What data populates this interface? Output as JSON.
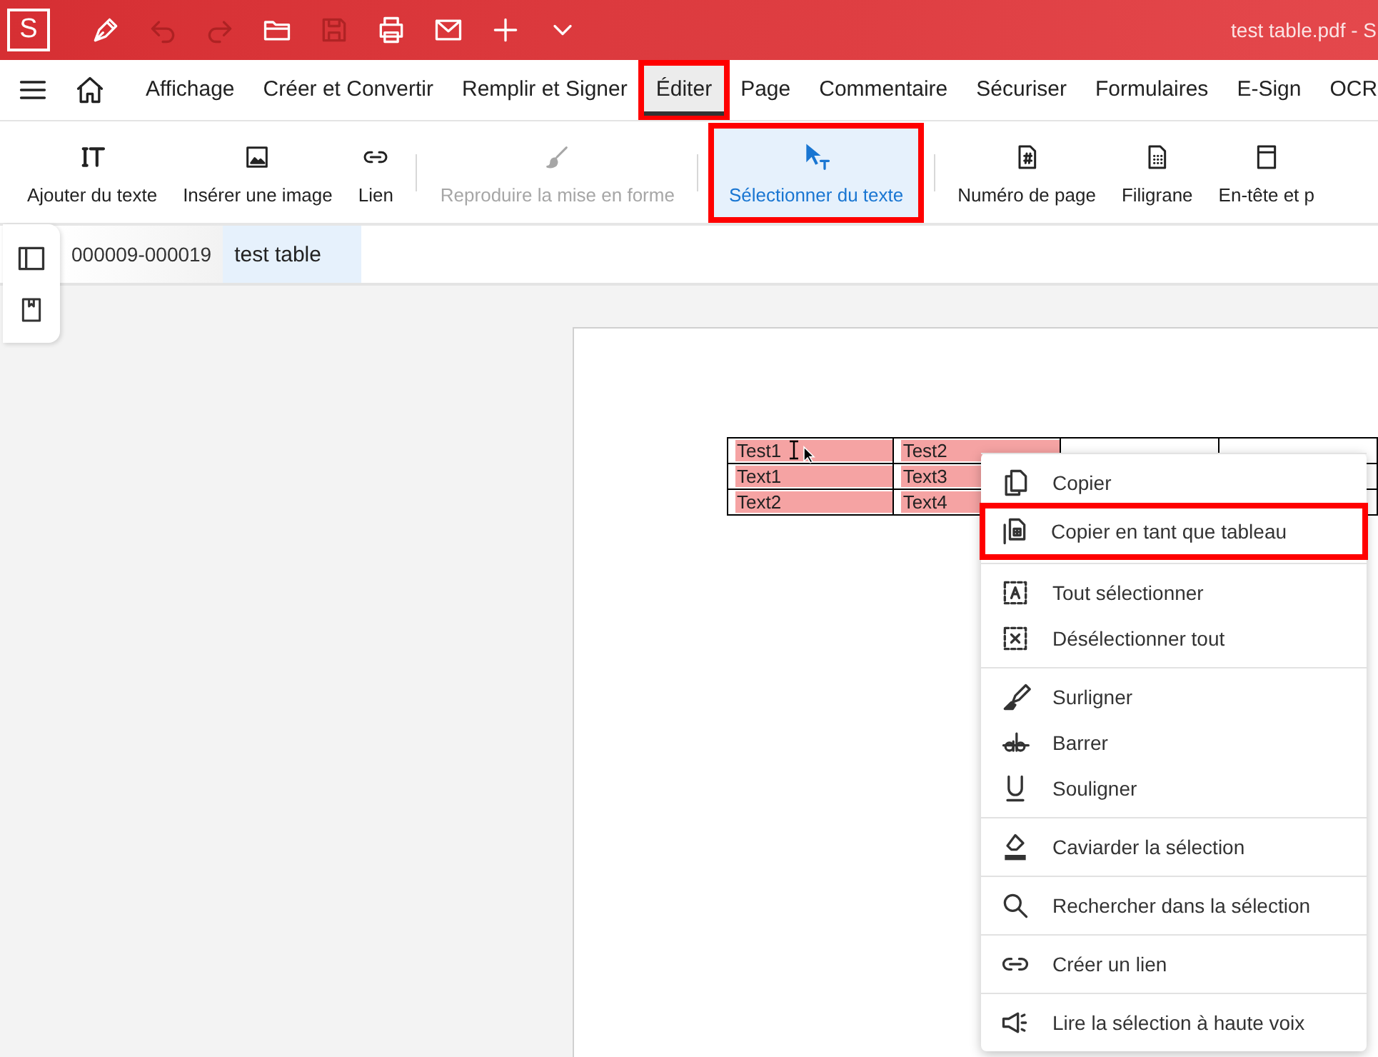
{
  "title_bar": {
    "logo": "S",
    "title": "test table.pdf  -  S",
    "tools": [
      {
        "kind": "pen",
        "disabled": false
      },
      {
        "kind": "undo",
        "disabled": true
      },
      {
        "kind": "redo",
        "disabled": true
      },
      {
        "kind": "folder",
        "disabled": false
      },
      {
        "kind": "save",
        "disabled": true
      },
      {
        "kind": "print",
        "disabled": false
      },
      {
        "kind": "mail",
        "disabled": false
      },
      {
        "kind": "plus",
        "disabled": false
      },
      {
        "kind": "chevron",
        "disabled": false
      }
    ]
  },
  "menu_bar": {
    "tabs": [
      {
        "label": "Affichage",
        "selected": false,
        "highlighted": false
      },
      {
        "label": "Créer et Convertir",
        "selected": false,
        "highlighted": false
      },
      {
        "label": "Remplir et Signer",
        "selected": false,
        "highlighted": false
      },
      {
        "label": "Éditer",
        "selected": true,
        "highlighted": true
      },
      {
        "label": "Page",
        "selected": false,
        "highlighted": false
      },
      {
        "label": "Commentaire",
        "selected": false,
        "highlighted": false
      },
      {
        "label": "Sécuriser",
        "selected": false,
        "highlighted": false
      },
      {
        "label": "Formulaires",
        "selected": false,
        "highlighted": false
      },
      {
        "label": "E-Sign",
        "selected": false,
        "highlighted": false
      },
      {
        "label": "OCR",
        "selected": false,
        "highlighted": false
      }
    ]
  },
  "toolbar": {
    "groups": [
      [
        {
          "kind": "add-text",
          "label": "Ajouter du texte",
          "disabled": false,
          "selected": false,
          "highlighted": false
        },
        {
          "kind": "image",
          "label": "Insérer une image",
          "disabled": false,
          "selected": false,
          "highlighted": false
        },
        {
          "kind": "link",
          "label": "Lien",
          "disabled": false,
          "selected": false,
          "highlighted": false
        }
      ],
      [
        {
          "kind": "brush",
          "label": "Reproduire la mise en forme",
          "disabled": true,
          "selected": false,
          "highlighted": false
        }
      ],
      [
        {
          "kind": "select-text",
          "label": "Sélectionner du texte",
          "disabled": false,
          "selected": true,
          "highlighted": true
        }
      ],
      [
        {
          "kind": "page-number",
          "label": "Numéro de page",
          "disabled": false,
          "selected": false,
          "highlighted": false
        },
        {
          "kind": "watermark",
          "label": "Filigrane",
          "disabled": false,
          "selected": false,
          "highlighted": false
        },
        {
          "kind": "header",
          "label": "En-tête et p",
          "disabled": false,
          "selected": false,
          "highlighted": false
        }
      ]
    ]
  },
  "doc_tabs": [
    {
      "label": "000009-000019",
      "selected": false
    },
    {
      "label": "test table",
      "selected": true
    }
  ],
  "table": {
    "rows": [
      {
        "cells": [
          "Test1",
          "Test2"
        ],
        "selected": true
      },
      {
        "cells": [
          "Text1",
          "Text3"
        ],
        "selected": true
      },
      {
        "cells": [
          "Text2",
          "Text4"
        ],
        "selected": true
      }
    ]
  },
  "context_menu": {
    "groups": [
      [
        {
          "kind": "copy",
          "label": "Copier",
          "highlighted": false
        },
        {
          "kind": "copy-table",
          "label": "Copier en tant que tableau",
          "highlighted": true
        }
      ],
      [
        {
          "kind": "select-all",
          "label": "Tout sélectionner",
          "highlighted": false
        },
        {
          "kind": "deselect",
          "label": "Désélectionner tout",
          "highlighted": false
        }
      ],
      [
        {
          "kind": "highlighter",
          "label": "Surligner",
          "highlighted": false
        },
        {
          "kind": "strike",
          "label": "Barrer",
          "highlighted": false
        },
        {
          "kind": "underline",
          "label": "Souligner",
          "highlighted": false
        }
      ],
      [
        {
          "kind": "eraser",
          "label": "Caviarder la sélection",
          "highlighted": false
        }
      ],
      [
        {
          "kind": "search",
          "label": "Rechercher dans la sélection",
          "highlighted": false
        }
      ],
      [
        {
          "kind": "link",
          "label": "Créer un lien",
          "highlighted": false
        }
      ],
      [
        {
          "kind": "megaphone",
          "label": "Lire la sélection à haute voix",
          "highlighted": false
        }
      ]
    ]
  }
}
